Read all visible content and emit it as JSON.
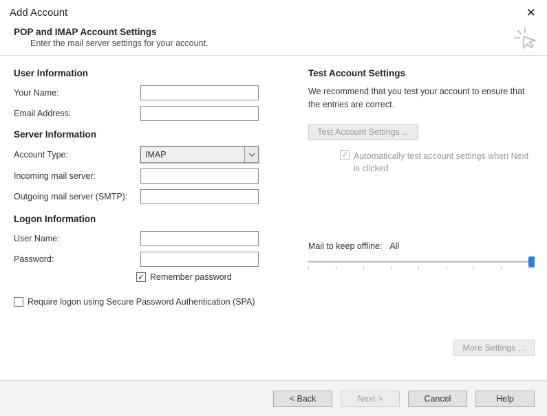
{
  "window": {
    "title": "Add Account"
  },
  "header": {
    "title": "POP and IMAP Account Settings",
    "subtitle": "Enter the mail server settings for your account."
  },
  "left": {
    "user_info_heading": "User Information",
    "your_name_label": "Your Name:",
    "your_name_value": "",
    "email_label": "Email Address:",
    "email_value": "",
    "server_info_heading": "Server Information",
    "account_type_label": "Account Type:",
    "account_type_value": "IMAP",
    "incoming_label": "Incoming mail server:",
    "incoming_value": "",
    "outgoing_label": "Outgoing mail server (SMTP):",
    "outgoing_value": "",
    "logon_info_heading": "Logon Information",
    "username_label": "User Name:",
    "username_value": "",
    "password_label": "Password:",
    "password_value": "",
    "remember_label": "Remember password",
    "spa_label": "Require logon using Secure Password Authentication (SPA)"
  },
  "right": {
    "test_heading": "Test Account Settings",
    "test_text": "We recommend that you test your account to ensure that the entries are correct.",
    "test_button": "Test Account Settings ...",
    "auto_test_label": "Automatically test account settings when Next is clicked",
    "mail_offline_label": "Mail to keep offline:",
    "mail_offline_value": "All",
    "more_settings": "More Settings ..."
  },
  "footer": {
    "back": "< Back",
    "next": "Next >",
    "cancel": "Cancel",
    "help": "Help"
  }
}
